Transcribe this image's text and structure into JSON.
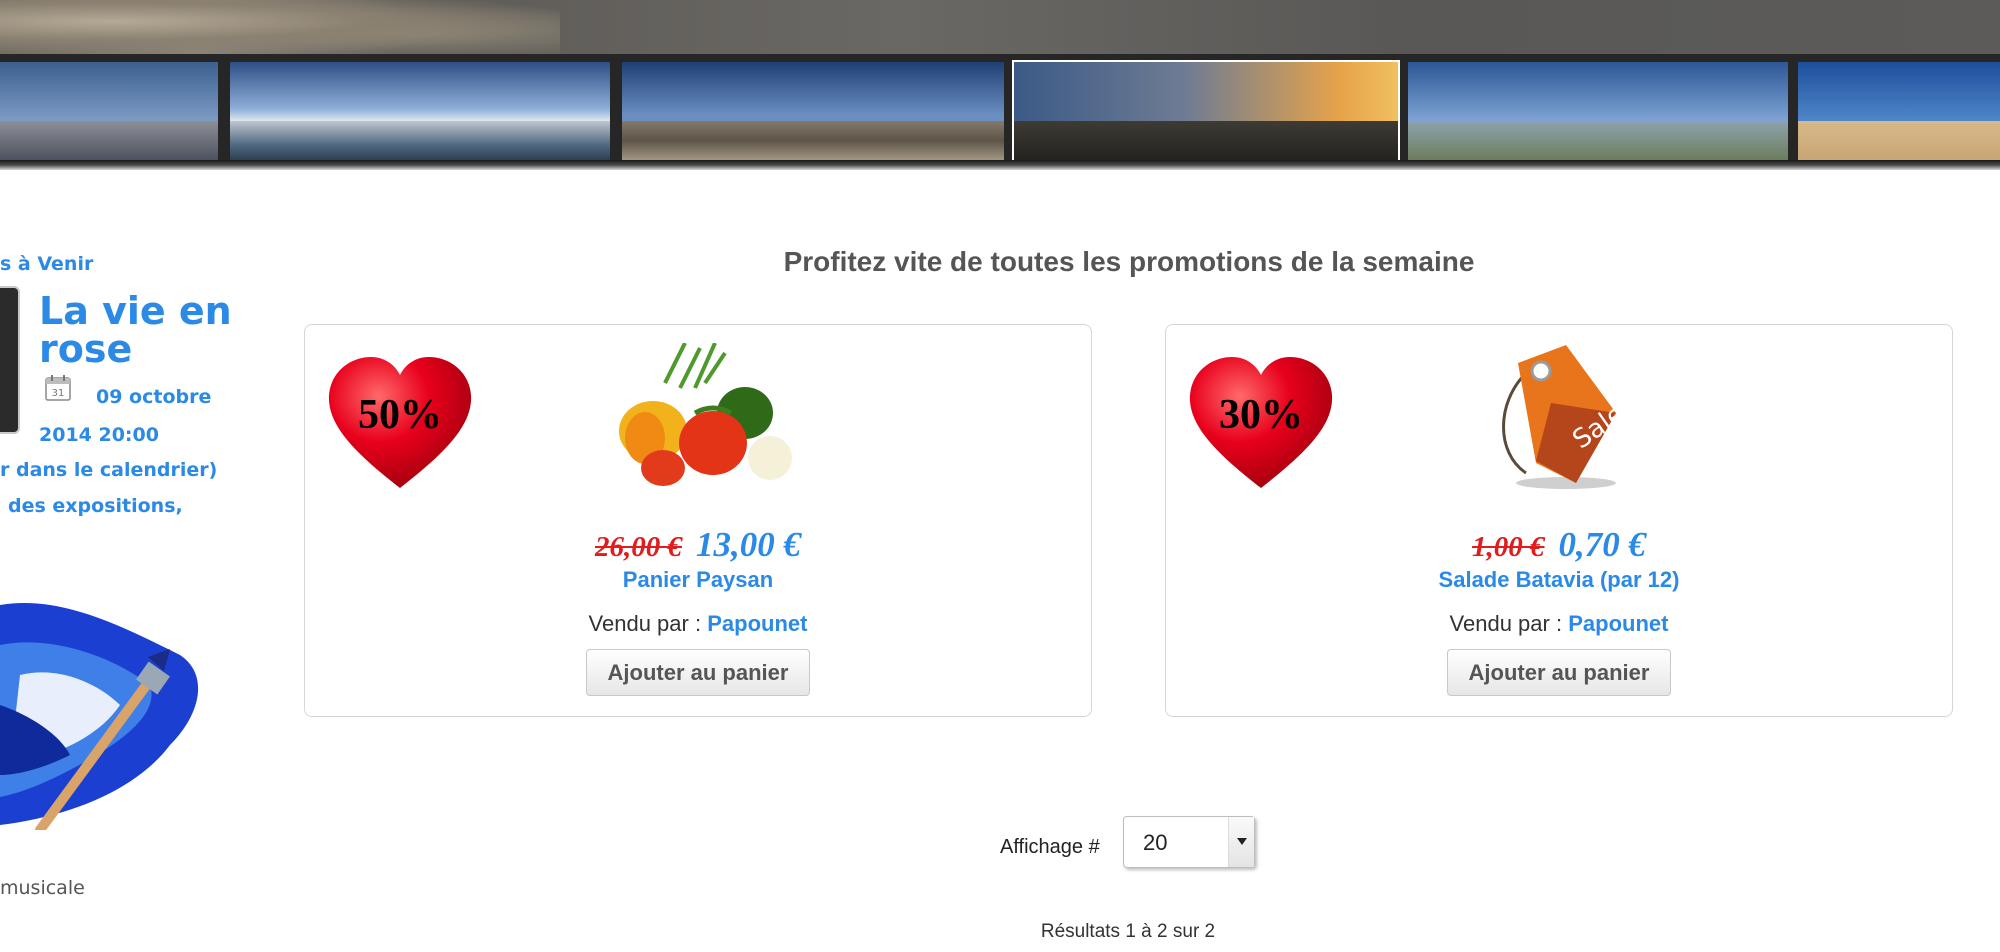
{
  "header": {
    "gallery_thumbnails": [
      "port-panorama",
      "harbour-panorama",
      "town-panorama",
      "sunset-panorama",
      "fishing-huts-panorama",
      "beach-panorama"
    ],
    "active_thumbnail": "sunset-panorama"
  },
  "sidebar": {
    "heading": "s à Venir",
    "event": {
      "title": "La vie en rose",
      "date": "09 octobre 2014 20:00",
      "calendar_link": "r dans le calendrier)",
      "description": "des expositions,"
    },
    "music_text": "musicale"
  },
  "main": {
    "heading": "Profitez vite de toutes les promotions de la semaine",
    "products": [
      {
        "discount": "50%",
        "image": "vegetables-image",
        "old_price": "26,00 €",
        "new_price": "13,00 €",
        "name": "Panier Paysan",
        "vendor_label": "Vendu par :",
        "vendor": "Papounet",
        "button": "Ajouter au panier"
      },
      {
        "discount": "30%",
        "image": "sale-tag-image",
        "old_price": "1,00 €",
        "new_price": "0,70 €",
        "name": "Salade Batavia (par 12)",
        "vendor_label": "Vendu par :",
        "vendor": "Papounet",
        "button": "Ajouter au panier"
      }
    ],
    "display": {
      "label": "Affichage #",
      "value": "20"
    },
    "results": "Résultats 1 à 2 sur 2"
  },
  "colors": {
    "accent": "#2a8ae6",
    "old_price": "#e01c1c",
    "heart": "#e8001c"
  }
}
